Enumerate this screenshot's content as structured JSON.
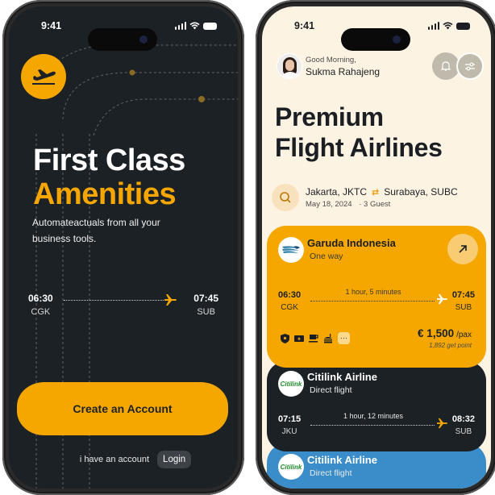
{
  "left_phone": {
    "status_bar": {
      "time": "9:41"
    },
    "hero": {
      "title_line1": "First Class",
      "title_line2": "Amenities",
      "subtitle": "Automateactuals from all your business tools."
    },
    "flight": {
      "departure_time": "06:30",
      "departure_code": "CGK",
      "arrival_time": "07:45",
      "arrival_code": "SUB"
    },
    "cta_label": "Create an Account",
    "login_prompt": "i have an account",
    "login_label": "Login",
    "colors": {
      "accent": "#f5a700",
      "background": "#1c2126"
    }
  },
  "right_phone": {
    "status_bar": {
      "time": "9:41"
    },
    "greeting": {
      "salutation": "Good Morning,",
      "name": "Sukma Rahajeng"
    },
    "page_title_line1": "Premium",
    "page_title_line2": "Flight Airlines",
    "search": {
      "from": "Jakarta, JKTC",
      "to": "Surabaya, SUBC",
      "date": "May 18, 2024",
      "guests": "· 3 Guest"
    },
    "flights": [
      {
        "airline": "Garuda Indonesia",
        "type": "One way",
        "departure_time": "06:30",
        "departure_code": "CGK",
        "arrival_time": "07:45",
        "arrival_code": "SUB",
        "duration": "1 hour, 5 minutes",
        "price": "€ 1,500",
        "price_unit": "/pax",
        "points": "1,892 get point",
        "amenities": [
          "shield-icon",
          "ticket-icon",
          "coffee-icon",
          "meal-icon"
        ],
        "more_label": "···",
        "color": "#f5a700"
      },
      {
        "airline": "Citilink Airline",
        "type": "Direct flight",
        "logo_text": "Citilink",
        "departure_time": "07:15",
        "departure_code": "JKU",
        "arrival_time": "08:32",
        "arrival_code": "SUB",
        "duration": "1 hour, 12 minutes",
        "color": "#1c2126"
      },
      {
        "airline": "Citilink Airline",
        "type": "Direct flight",
        "logo_text": "Citilink",
        "color": "#3a8dc9"
      }
    ],
    "colors": {
      "background": "#fdf3e2",
      "text": "#1b1f24"
    }
  }
}
